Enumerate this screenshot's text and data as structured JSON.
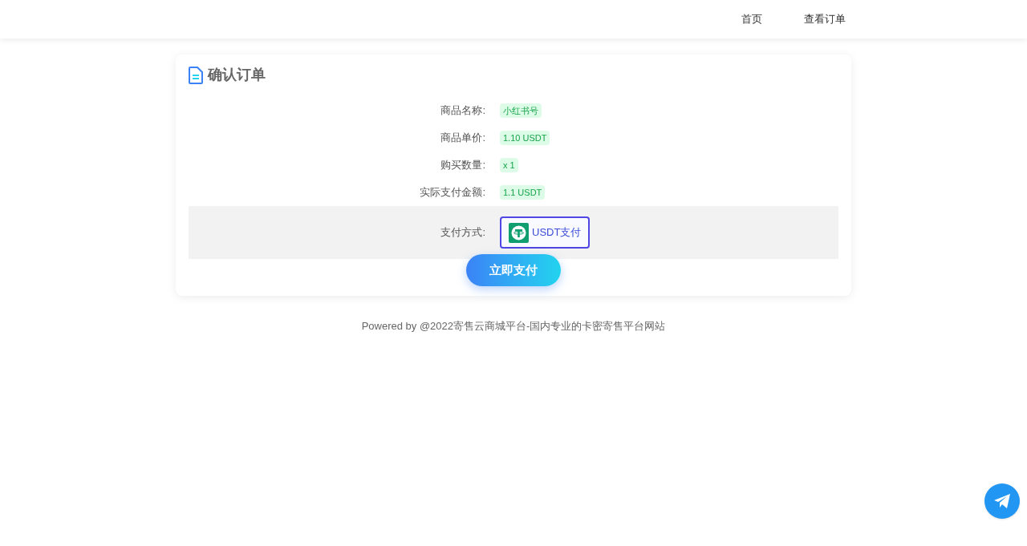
{
  "nav": {
    "items": [
      {
        "label": "首页"
      },
      {
        "label": "查看订单"
      }
    ]
  },
  "order": {
    "title": "确认订单",
    "fields": [
      {
        "label": "商品名称:",
        "value": "小红书号"
      },
      {
        "label": "商品单价:",
        "value": "1.10 USDT"
      },
      {
        "label": "购买数量:",
        "value": "x 1"
      },
      {
        "label": "实际支付金额:",
        "value": "1.1 USDT"
      }
    ],
    "payment": {
      "label": "支付方式:",
      "methods": [
        {
          "label": "USDT支付",
          "selected": true
        }
      ]
    },
    "submit": "立即支付"
  },
  "footer": "Powered by @2022寄售云商城平台-国内专业的卡密寄售平台网站"
}
